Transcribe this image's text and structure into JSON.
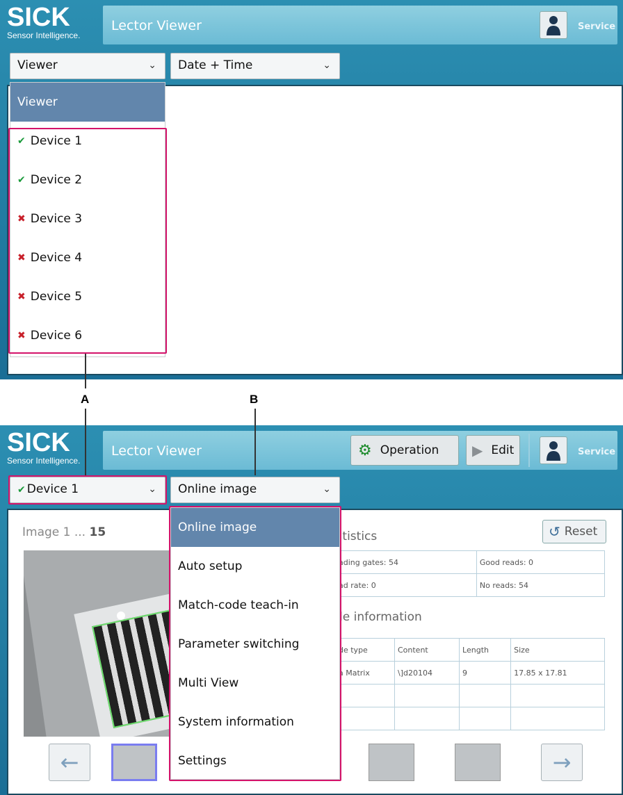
{
  "brand": {
    "name": "SICK",
    "tagline": "Sensor Intelligence."
  },
  "app_title": "Lector Viewer",
  "service_label": "Service",
  "top_screen": {
    "view_dropdown": {
      "value": "Viewer"
    },
    "time_dropdown": {
      "value": "Date + Time"
    },
    "menu": {
      "header": "Viewer",
      "devices": [
        {
          "label": "Device 1",
          "status": "ok"
        },
        {
          "label": "Device 2",
          "status": "ok"
        },
        {
          "label": "Device 3",
          "status": "error"
        },
        {
          "label": "Device 4",
          "status": "error"
        },
        {
          "label": "Device 5",
          "status": "error"
        },
        {
          "label": "Device 6",
          "status": "error"
        }
      ]
    }
  },
  "callouts": {
    "a": "A",
    "b": "B"
  },
  "bottom_screen": {
    "operation_label": "Operation",
    "edit_label": "Edit",
    "device_dropdown": {
      "value": "Device 1"
    },
    "mode_dropdown": {
      "value": "Online image"
    },
    "image_counter": {
      "prefix": "Image 1 ... ",
      "total": "15"
    },
    "reset_label": "Reset",
    "statistics_title": "atistics",
    "stats": {
      "reading_gates": "ading gates: 54",
      "good_reads": "Good reads: 0",
      "read_rate": "ad rate: 0",
      "no_reads": "No reads: 54"
    },
    "code_info_title": "de information",
    "code_table": {
      "headers": [
        "de type",
        "Content",
        "Length",
        "Size"
      ],
      "row": [
        "a Matrix",
        "\\]d20104",
        "9",
        "17.85 x 17.81"
      ]
    },
    "menu_items": [
      "Online image",
      "Auto setup",
      "Match-code teach-in",
      "Parameter switching",
      "Multi View",
      "System information",
      "Settings"
    ],
    "selected_item": "Online image"
  },
  "colors": {
    "accent_pink": "#d4136a",
    "selected_blue": "#6286ac",
    "header_blue": "#1a6e96"
  }
}
